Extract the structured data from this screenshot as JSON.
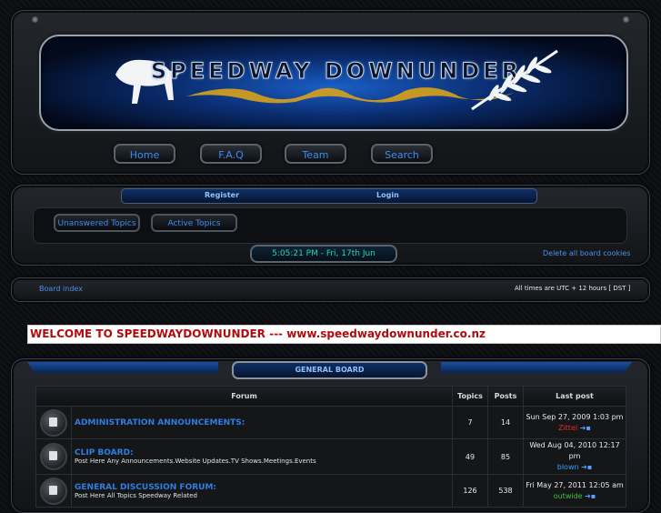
{
  "banner": {
    "title": "SPEEDWAY DOWNUNDER"
  },
  "nav": {
    "home": "Home",
    "faq": "F.A.Q",
    "team": "Team",
    "search": "Search"
  },
  "auth": {
    "register": "Register",
    "login": "Login"
  },
  "quick": {
    "unanswered": "Unanswered Topics",
    "active": "Active Topics"
  },
  "clock": "5:05:21 PM - Fri, 17th Jun",
  "cookies": "Delete all board cookies",
  "breadcrumb": {
    "board_index": "Board index",
    "timezone": "All times are UTC + 12 hours [ DST ]"
  },
  "welcome": "WELCOME TO SPEEDWAYDOWNUNDER --- www.speedwaydownunder.co.nz",
  "section": {
    "title": "GENERAL BOARD"
  },
  "table": {
    "headers": {
      "forum": "Forum",
      "topics": "Topics",
      "posts": "Posts",
      "last": "Last post"
    },
    "rows": [
      {
        "name": "ADMINISTRATION ANNOUNCEMENTS:",
        "desc": "",
        "topics": "7",
        "posts": "14",
        "date": "Sun Sep 27, 2009 1:03 pm",
        "user": "Zittel",
        "user_color": "#e03030",
        "icon": "locked-forum-icon"
      },
      {
        "name": "CLIP BOARD:",
        "desc": "Post Here Any Announcements.Website Updates.TV Shows.Meetings.Events",
        "topics": "49",
        "posts": "85",
        "date": "Wed Aug 04, 2010 12:17 pm",
        "user": "blown",
        "user_color": "#3a9bff",
        "icon": "forum-read-icon"
      },
      {
        "name": "GENERAL DISCUSSION FORUM:",
        "desc": "Post Here All Topics Speedway Related",
        "topics": "126",
        "posts": "538",
        "date": "Fri May 27, 2011 12:05 am",
        "user": "outwide",
        "user_color": "#3fbf3f",
        "icon": "forum-read-icon"
      }
    ]
  }
}
